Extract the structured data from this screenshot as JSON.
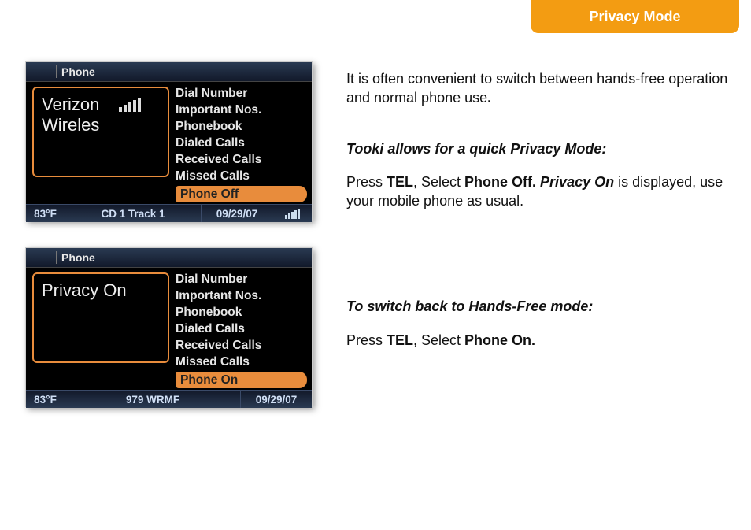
{
  "title": "Privacy Mode",
  "shot1": {
    "topLabel": "Phone",
    "displayLine1": "Verizon",
    "displayLine2": "Wireles",
    "menu": [
      "Dial Number",
      "Important Nos.",
      "Phonebook",
      "Dialed Calls",
      "Received Calls",
      "Missed Calls"
    ],
    "selected": "Phone Off",
    "temp": "83°F",
    "mid": "CD 1 Track 1",
    "date": "09/29/07"
  },
  "shot2": {
    "topLabel": "Phone",
    "displayLine1": "Privacy On",
    "menu": [
      "Dial Number",
      "Important Nos.",
      "Phonebook",
      "Dialed Calls",
      "Received Calls",
      "Missed Calls"
    ],
    "selected": "Phone On",
    "temp": "83°F",
    "mid": "979 WRMF",
    "date": "09/29/07"
  },
  "text": {
    "intro": "It is often convenient to switch between hands-free operation and normal phone use",
    "dot": ".",
    "h1": "Tooki allows for a quick Privacy Mode:",
    "p1_a": "Press ",
    "p1_b": "TEL",
    "p1_c": ", Select  ",
    "p1_d": "Phone Off. ",
    "p1_e": "Privacy On",
    "p1_f": " is displayed, use your mobile phone as usual.",
    "h2": "To switch back to Hands-Free mode:",
    "p2_a": "Press ",
    "p2_b": "TEL",
    "p2_c": ", Select  ",
    "p2_d": "Phone On."
  }
}
